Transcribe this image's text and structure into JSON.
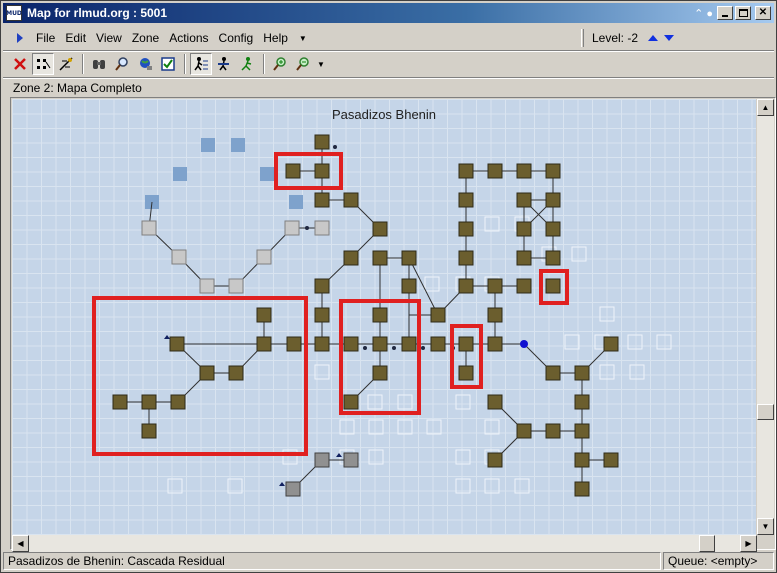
{
  "window": {
    "title": "Map for rlmud.org : 5001",
    "title_extra": "⌃ ●",
    "icon_text": "MUD"
  },
  "menu": {
    "items": [
      "File",
      "Edit",
      "View",
      "Zone",
      "Actions",
      "Config",
      "Help"
    ],
    "level_label": "Level: -2"
  },
  "toolbar": {
    "tools": [
      "delete-icon",
      "select-mode-icon",
      "draw-exits-icon",
      "binoculars-icon",
      "find-icon",
      "globe-icon",
      "checkbox-icon",
      "walk-mode-icon",
      "walk-icon-2",
      "run-icon",
      "zoom-in-icon",
      "zoom-out-icon"
    ]
  },
  "zone": {
    "label": "Zone 2: Mapa Completo"
  },
  "map": {
    "area_title": "Pasadizos Bhenin"
  },
  "status": {
    "room": "Pasadizos de Bhenin: Cascada Residual",
    "queue": "Queue: <empty>"
  },
  "colors": {
    "room": "#6b5e2e",
    "room_border": "#2e2a18",
    "faded_room": "#7ea2cc",
    "grey_room": "#c8c8c8",
    "highlight": "#e02020",
    "titlebar": "#0a246a",
    "map_bg": "#c5d5e8",
    "current_room_marker": "#1010d0"
  }
}
